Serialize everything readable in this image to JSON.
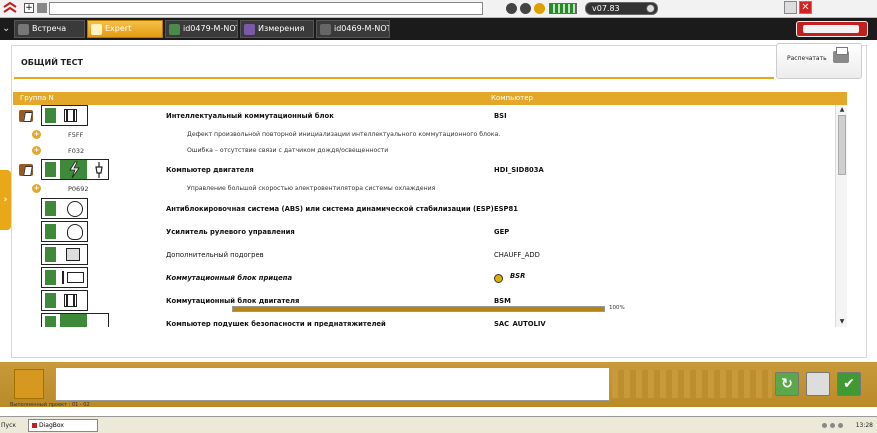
{
  "topbar": {
    "version": "v07.83"
  },
  "tabs": [
    {
      "label": "Встреча"
    },
    {
      "label": "Expert"
    },
    {
      "label": "id0479-M-NOT..."
    },
    {
      "label": "Измерения"
    },
    {
      "label": "id0469-M-NOT..."
    }
  ],
  "panel": {
    "title": "ОБЩИЙ ТЕСТ",
    "print_label": "Распечатать"
  },
  "table": {
    "col_group": "Группа N",
    "col_computer": "Компьютер",
    "rows": [
      {
        "kind": "ecu",
        "name": "Интеллектуальный коммутационный блок",
        "computer": "BSI"
      },
      {
        "kind": "fault",
        "code": "F5FF",
        "desc": "Дефект произвольной повторной инициализации интеллектуального коммутационного блока."
      },
      {
        "kind": "fault",
        "code": "F032",
        "desc": "Ошибка – отсутствие связи с датчиком дождя/освещенности"
      },
      {
        "kind": "ecu",
        "name": "Компьютер двигателя",
        "computer": "HDI_SID803A"
      },
      {
        "kind": "fault",
        "code": "P0692",
        "desc": "Управление большой скоростью электровентилятора системы охлаждения"
      },
      {
        "kind": "ecu",
        "name": "Антиблокировочная система (ABS) или система динамической стабилизации (ESP)",
        "computer": "ESP81"
      },
      {
        "kind": "ecu",
        "name": "Усилитель рулевого управления",
        "computer": "GEP"
      },
      {
        "kind": "ecu",
        "name": "Дополнительный подогрев",
        "computer": "CHAUFF_ADD"
      },
      {
        "kind": "ecu",
        "name": "Коммутационный блок прицепа",
        "computer": "BSR"
      },
      {
        "kind": "ecu",
        "name": "Коммутационный блок двигателя",
        "computer": "BSM"
      },
      {
        "kind": "ecu",
        "name": "Компьютер подушек безопасности и преднатяжителей",
        "computer": "SAC_AUTOLIV"
      }
    ]
  },
  "progress": {
    "value": 1.0,
    "label": "100%"
  },
  "status": {
    "text": "Выполненный проект : 01 - 02"
  },
  "taskbar": {
    "start": "Пуск",
    "app": "DiagBox",
    "clock": "13:28"
  },
  "colors": {
    "accent": "#e3a82a",
    "tab_active": "#e59b10",
    "header_bg": "#1b1b1b"
  }
}
